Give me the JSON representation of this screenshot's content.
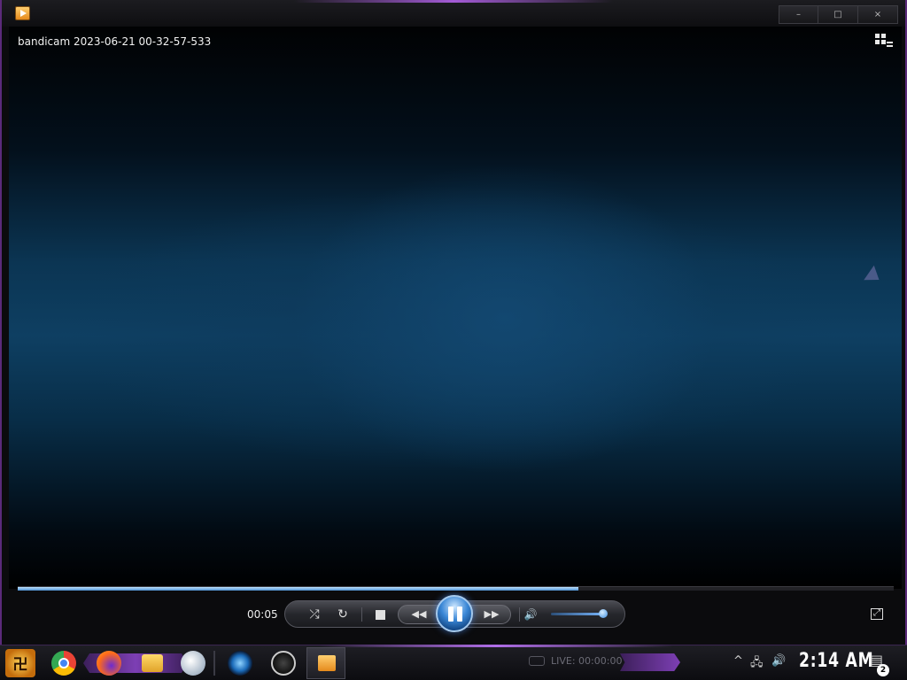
{
  "window": {
    "controls": {
      "minimize": "–",
      "maximize": "□",
      "close": "×"
    }
  },
  "video": {
    "title": "bandicam 2023-06-21 00-32-57-533"
  },
  "playback": {
    "elapsed": "00:05",
    "progress_fraction": 0.64,
    "volume_fraction": 0.95
  },
  "controls": {
    "shuffle": "⤮",
    "repeat": "↻",
    "previous": "◀◀",
    "next": "▶▶",
    "mute": "🔊",
    "fullscreen": "⤢"
  },
  "taskbar": {
    "start_label": "卍",
    "live_status": "LIVE: 00:00:00",
    "clock": "2:14 AM",
    "notifications_count": "2",
    "tray_chevron": "^",
    "network": "🖧",
    "volume": "🔊",
    "action_center": "▤"
  },
  "colors": {
    "accent_purple": "#7d3fb4",
    "seek_fill": "#4c8fd0",
    "play_button": "#3a87d6"
  }
}
